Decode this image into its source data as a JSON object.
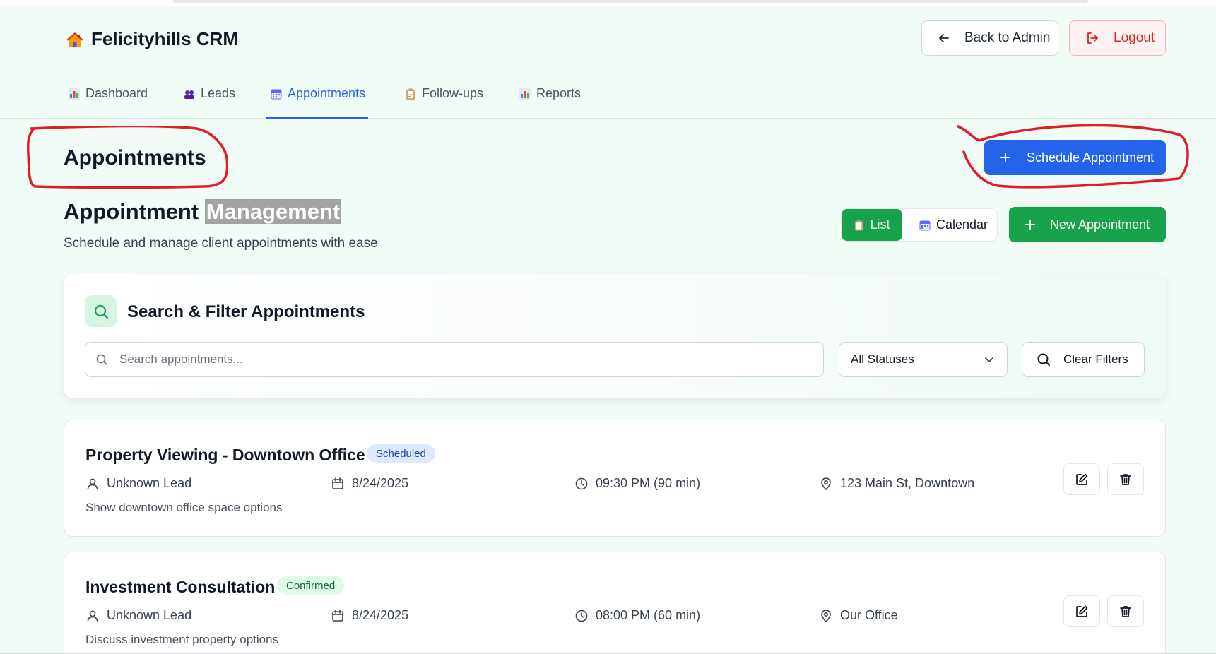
{
  "app": {
    "title": "Felicityhills CRM"
  },
  "header": {
    "back_label": "Back to Admin",
    "logout_label": "Logout"
  },
  "tabs": [
    {
      "label": "Dashboard",
      "icon": "bar-chart-icon"
    },
    {
      "label": "Leads",
      "icon": "people-icon"
    },
    {
      "label": "Appointments",
      "icon": "calendar-icon"
    },
    {
      "label": "Follow-ups",
      "icon": "clipboard-icon"
    },
    {
      "label": "Reports",
      "icon": "bar-chart-icon"
    }
  ],
  "page": {
    "title": "Appointments",
    "schedule_label": "Schedule Appointment",
    "mgmt_title_a": "Appointment",
    "mgmt_title_b": "Management",
    "subtitle": "Schedule and manage client appointments with ease",
    "view_list": "List",
    "view_calendar": "Calendar",
    "new_label": "New Appointment"
  },
  "filters": {
    "title": "Search & Filter Appointments",
    "search_placeholder": "Search appointments...",
    "status_selected": "All Statuses",
    "clear_label": "Clear Filters"
  },
  "appointments": [
    {
      "title": "Property Viewing - Downtown Office",
      "status": "Scheduled",
      "lead": "Unknown Lead",
      "date": "8/24/2025",
      "time": "09:30 PM (90 min)",
      "location": "123 Main St, Downtown",
      "description": "Show downtown office space options"
    },
    {
      "title": "Investment Consultation",
      "status": "Confirmed",
      "lead": "Unknown Lead",
      "date": "8/24/2025",
      "time": "08:00 PM (60 min)",
      "location": "Our Office",
      "description": "Discuss investment property options"
    }
  ],
  "colors": {
    "primary": "#2563eb",
    "success": "#16a34a",
    "danger": "#dc2626",
    "annotation": "#e11d2a"
  }
}
